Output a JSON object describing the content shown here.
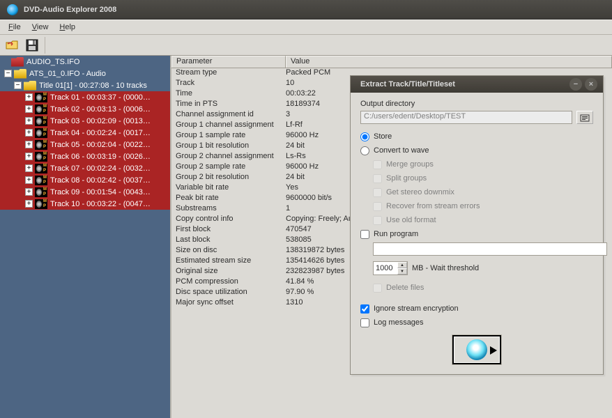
{
  "app_title": "DVD-Audio Explorer 2008",
  "menu": [
    "File",
    "View",
    "Help"
  ],
  "tree": {
    "root": {
      "label": "AUDIO_TS.IFO"
    },
    "ats": {
      "label": "ATS_01_0.IFO - Audio"
    },
    "title": {
      "label": "Title 01[1] - 00:27:08 - 10 tracks"
    },
    "tracks": [
      "Track 01 - 00:03:37 - (0000…",
      "Track 02 - 00:03:13 - (0006…",
      "Track 03 - 00:02:09 - (0013…",
      "Track 04 - 00:02:24 - (0017…",
      "Track 05 - 00:02:04 - (0022…",
      "Track 06 - 00:03:19 - (0026…",
      "Track 07 - 00:02:24 - (0032…",
      "Track 08 - 00:02:42 - (0037…",
      "Track 09 - 00:01:54 - (0043…",
      "Track 10 - 00:03:22 - (0047…"
    ]
  },
  "details": {
    "headers": {
      "param": "Parameter",
      "value": "Value"
    },
    "rows": [
      [
        "Stream type",
        "Packed PCM"
      ],
      [
        "Track",
        "10"
      ],
      [
        "Time",
        "00:03:22"
      ],
      [
        "Time in PTS",
        "18189374"
      ],
      [
        "Channel assignment id",
        "3"
      ],
      [
        "Group 1 channel assignment",
        "Lf-Rf"
      ],
      [
        "Group 1 sample rate",
        "96000 Hz"
      ],
      [
        "Group 1 bit resolution",
        "24 bit"
      ],
      [
        "Group 2 channel assignment",
        "Ls-Rs"
      ],
      [
        "Group 2 sample rate",
        "96000 Hz"
      ],
      [
        "Group 2 bit resolution",
        "24 bit"
      ],
      [
        "Variable bit rate",
        "Yes"
      ],
      [
        "Peak bit rate",
        "9600000 bit/s"
      ],
      [
        "Substreams",
        "1"
      ],
      [
        "Copy control info",
        "Copying: Freely; Audio quality: ?"
      ],
      [
        "First block",
        "470547"
      ],
      [
        "Last block",
        "538085"
      ],
      [
        "Size on disc",
        "138319872 bytes"
      ],
      [
        "Estimated stream size",
        "135414626 bytes"
      ],
      [
        "Original size",
        "232823987 bytes"
      ],
      [
        "PCM compression",
        "41.84 %"
      ],
      [
        "Disc space utilization",
        "97.90 %"
      ],
      [
        "Major sync offset",
        "1310"
      ]
    ]
  },
  "dialog": {
    "title": "Extract Track/Title/Titleset",
    "out_label": "Output directory",
    "out_value": "C:/users/edent/Desktop/TEST",
    "radio_store": "Store",
    "radio_convert": "Convert to wave",
    "cb_merge": "Merge groups",
    "cb_split": "Split groups",
    "cb_stereo": "Get stereo downmix",
    "cb_recover": "Recover from stream errors",
    "cb_oldfmt": "Use old format",
    "cb_run": "Run program",
    "mb_value": "1000",
    "mb_label": "MB - Wait threshold",
    "cb_delete": "Delete files",
    "cb_ignore": "Ignore stream encryption",
    "cb_log": "Log messages"
  }
}
